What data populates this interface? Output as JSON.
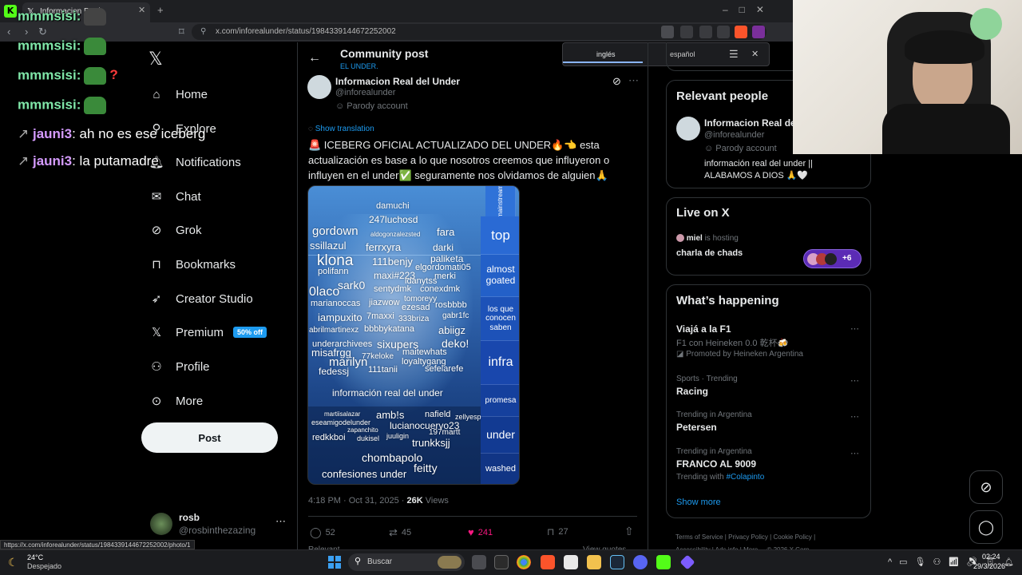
{
  "browser": {
    "tab_title": "Informacion Real",
    "url": "x.com/inforealunder/status/1984339144672252002"
  },
  "translate": {
    "from": "inglés",
    "to": "español"
  },
  "chat": [
    {
      "user": "mmmsisi:",
      "text": ""
    },
    {
      "user": "mmmsisi:",
      "text": ""
    },
    {
      "user": "mmmsisi:",
      "text": ""
    },
    {
      "user": "mmmsisi:",
      "text": ""
    },
    {
      "user": "jauni3",
      "text": ": ah no es ese iceberg"
    },
    {
      "user": "jauni3",
      "text": ": la putamadre"
    }
  ],
  "nav": {
    "items": [
      "Home",
      "Explore",
      "Notifications",
      "Chat",
      "Grok",
      "Bookmarks",
      "Creator Studio",
      "Premium",
      "Profile",
      "More"
    ],
    "premium_badge": "50% off",
    "post_button": "Post",
    "account_name": "rosb",
    "account_handle": "@rosbinthezazing"
  },
  "header": {
    "title": "Community post",
    "community": "EL UNDER."
  },
  "tweet": {
    "author": "Informacion Real del Under",
    "handle": "@inforealunder",
    "badge": "Parody account",
    "show_translation": "Show translation",
    "text": "🚨 ICEBERG OFICIAL ACTUALIZADO DEL UNDER🔥👈 esta actualización es base a lo que nosotros creemos que influyeron o influyen en el under✅ seguramente nos olvidamos de alguien🙏",
    "time": "4:18 PM · Oct 31, 2025 · ",
    "views_count": "26K",
    "views_label": " Views",
    "replies": "52",
    "reposts": "45",
    "likes": "241",
    "bookmarks": "27",
    "relevant_label": "Relevant",
    "view_quotes": "View quotes"
  },
  "iceberg": {
    "tiers": [
      "mainstream",
      "top",
      "almost goated",
      "los que conocen saben",
      "infra",
      "promesa",
      "under",
      "washed"
    ],
    "names": [
      "damuchi",
      "247luchosd",
      "gordown",
      "ssillazul",
      "fara",
      "darki",
      "ferrxyra",
      "aldogonzalezsted",
      "klona",
      "111benjy",
      "paliketa",
      "elgordomati05",
      "merki",
      "polifann",
      "maxi#223",
      "sark0",
      "idanytss",
      "sentydmk",
      "conexdmk",
      "0laco",
      "marianoccas",
      "jiazwow",
      "tomoreyy",
      "ezesad",
      "rosbbbb",
      "iampuxito",
      "7maxxi",
      "333briza",
      "gabr1fc",
      "abrilmartinexz",
      "bbbbykatana",
      "abiigz",
      "underarchivees",
      "sixupers",
      "deko!",
      "misafrgg",
      "77keloke",
      "maitewhats",
      "marilyn",
      "loyaltygang",
      "fedessj",
      "111tanii",
      "sefelarefe",
      "información real del under",
      "martiisalazar",
      "amb!s",
      "nafield",
      "zellyesp",
      "eseamigodelunder",
      "lucianocuervo23",
      "zapanchito",
      "197martt",
      "redkkboi",
      "dukisel",
      "juuligin",
      "trunkksjj",
      "chombapolo",
      "feitty",
      "confesiones under"
    ]
  },
  "right": {
    "relevant_title": "Relevant people",
    "person_name": "Informacion Real de...",
    "person_handle": "@inforealunder",
    "person_badge": "Parody account",
    "person_bio": "información real del under || ALABAMOS A DIOS 🙏🤍",
    "live_title": "Live on X",
    "live_host": "miel",
    "live_host_suffix": " is hosting",
    "live_space": "charla de chads",
    "live_count": "+6",
    "happening_title": "What’s happening",
    "trends": [
      {
        "meta": "",
        "name": "Viajá a la F1",
        "sub": "F1 con Heineken 0.0 乾杯🍻",
        "promo": "Promoted by Heineken Argentina"
      },
      {
        "meta": "Sports · Trending",
        "name": "Racing",
        "sub": "",
        "promo": ""
      },
      {
        "meta": "Trending in Argentina",
        "name": "Petersen",
        "sub": "",
        "promo": ""
      },
      {
        "meta": "Trending in Argentina",
        "name": "FRANCO AL 9009",
        "sub": "Trending with ",
        "tag": "#Colapinto",
        "promo": ""
      }
    ],
    "show_more": "Show more",
    "footer": [
      "Terms of Service",
      "Privacy Policy",
      "Cookie Policy",
      "Accessibility",
      "Ads info",
      "More ...",
      "© 2026 X Corp."
    ]
  },
  "statusbar": {
    "link": "https://x.com/inforealunder/status/1984339144672252002/photo/1"
  },
  "taskbar": {
    "weather_temp": "24°C",
    "weather_desc": "Despejado",
    "search": "Buscar",
    "time": "02:24",
    "date": "29/3/2026"
  },
  "colors": {
    "accent": "#1d9bf0",
    "like": "#f91880",
    "bg": "#000000",
    "border": "#2f3336"
  }
}
